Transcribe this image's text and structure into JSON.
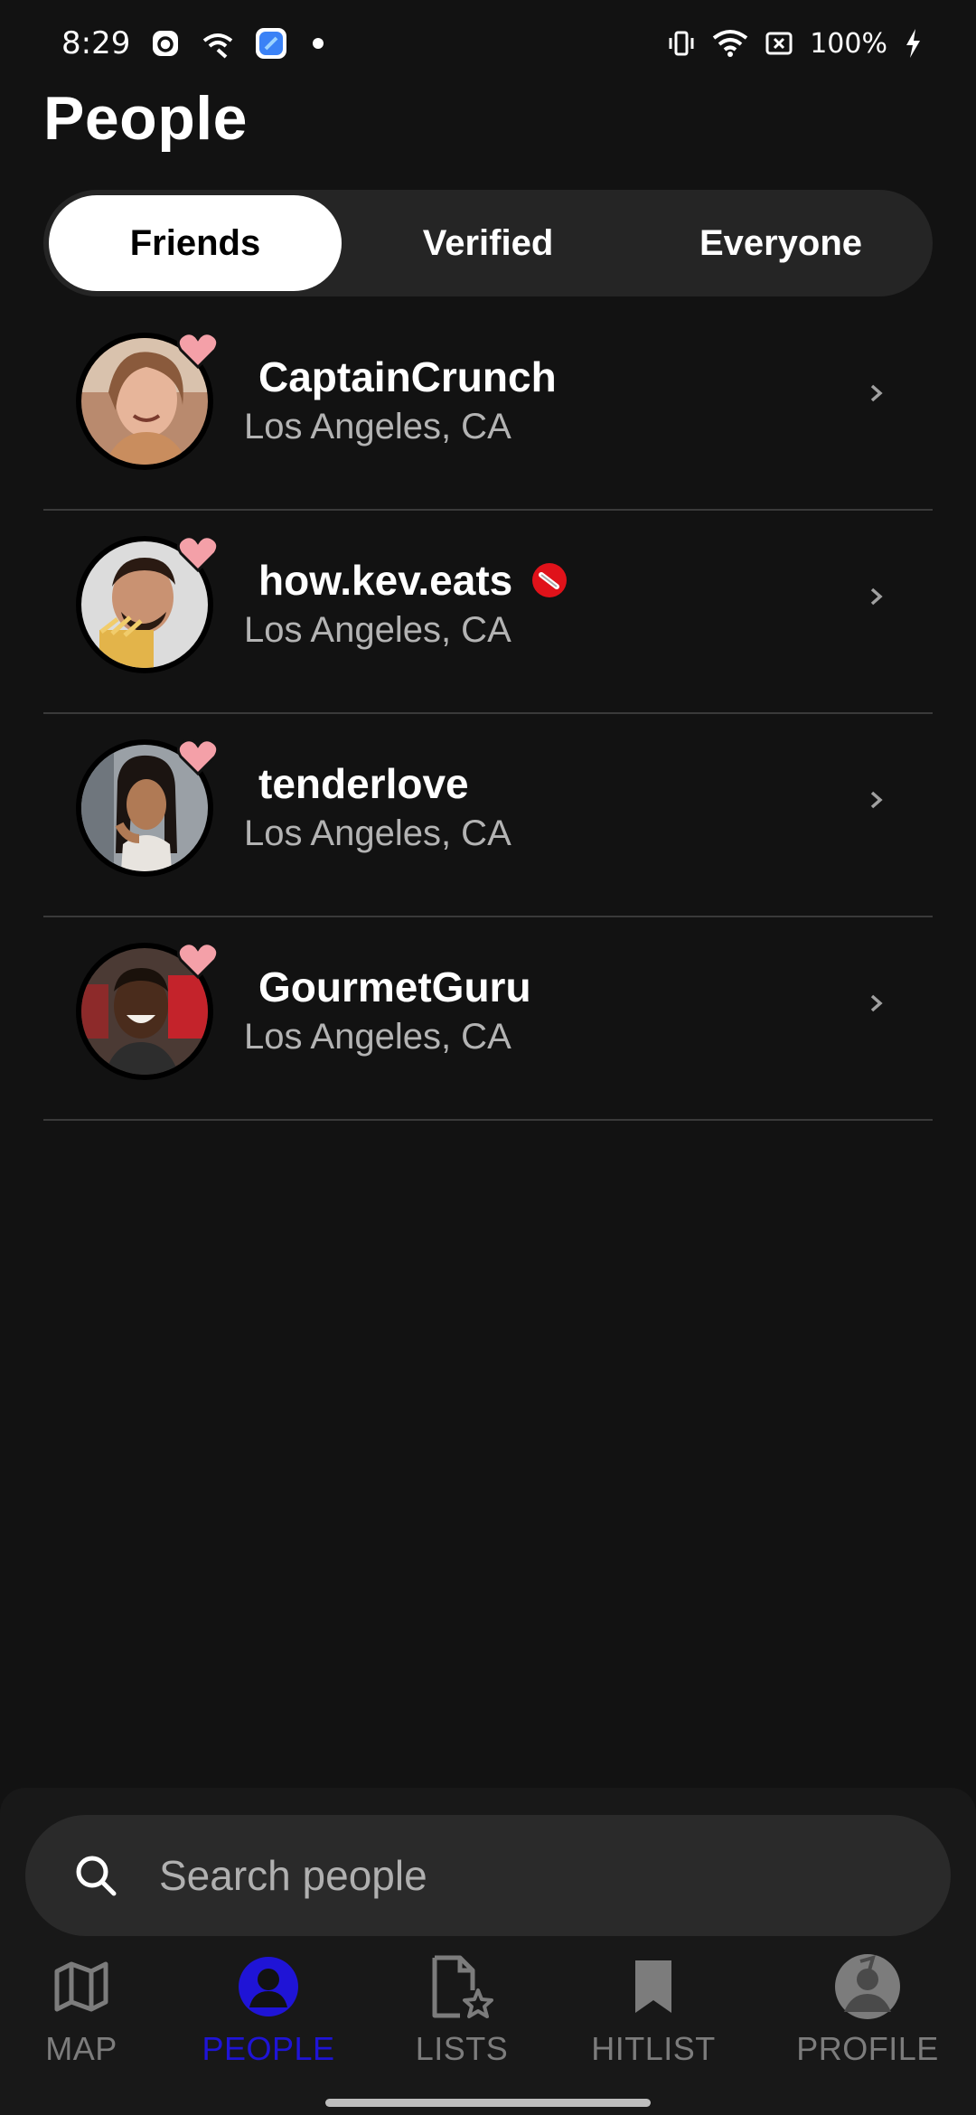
{
  "status_bar": {
    "time": "8:29",
    "battery": "100%",
    "icons": [
      "threads-icon",
      "wireless-icon",
      "app-icon",
      "dot-icon",
      "vibrate-icon",
      "wifi-icon",
      "data-off-icon",
      "charging-icon"
    ]
  },
  "header": {
    "title": "People"
  },
  "tabs": [
    {
      "label": "Friends",
      "active": true
    },
    {
      "label": "Verified",
      "active": false
    },
    {
      "label": "Everyone",
      "active": false
    }
  ],
  "people": [
    {
      "name": "CaptainCrunch",
      "location": "Los Angeles, CA",
      "verified": false
    },
    {
      "name": "how.kev.eats",
      "location": "Los Angeles, CA",
      "verified": true
    },
    {
      "name": "tenderlove",
      "location": "Los Angeles, CA",
      "verified": false
    },
    {
      "name": "GourmetGuru",
      "location": "Los Angeles, CA",
      "verified": false
    }
  ],
  "search": {
    "placeholder": "Search people"
  },
  "nav": [
    {
      "label": "MAP",
      "icon": "map-icon",
      "active": false
    },
    {
      "label": "PEOPLE",
      "icon": "person-icon",
      "active": true
    },
    {
      "label": "LISTS",
      "icon": "list-doc-icon",
      "active": false
    },
    {
      "label": "HITLIST",
      "icon": "bookmark-icon",
      "active": false
    },
    {
      "label": "PROFILE",
      "icon": "profile-avatar-icon",
      "active": false
    }
  ],
  "colors": {
    "background": "#121212",
    "heart": "#f4a0a8",
    "active_nav": "#1f14d6",
    "verified_badge": "#e0121a"
  }
}
